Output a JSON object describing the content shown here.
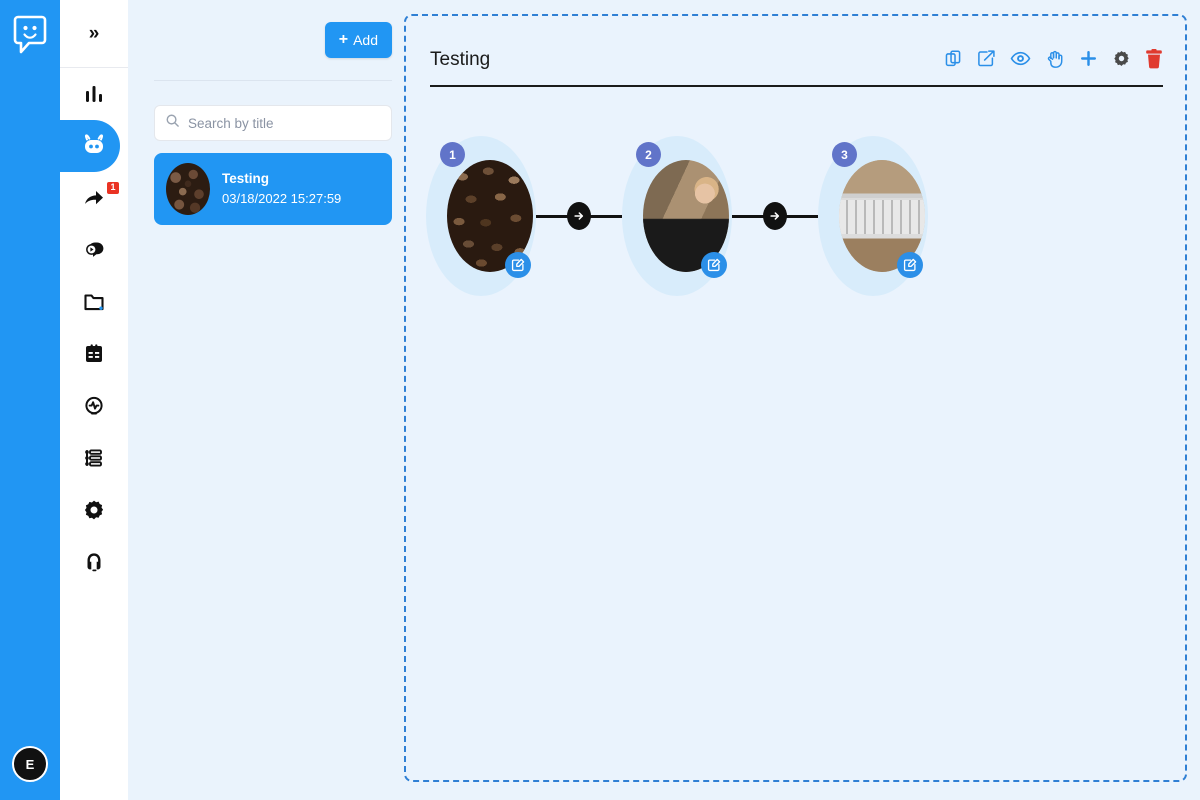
{
  "app": {
    "logo_icon": "chat-smiley-logo",
    "accent_color": "#2196f3",
    "canvas_bg": "#eaf3fd",
    "dashed_border_color": "#2f7fd4",
    "badge_color": "#6174c9",
    "danger_color": "#e03a2f"
  },
  "rail": {
    "avatar_initial": "E",
    "avatar_name": "user-avatar"
  },
  "iconbar": {
    "collapse_label": "»",
    "items": [
      {
        "name": "analytics",
        "icon": "bar-chart-icon",
        "active": false,
        "badge": ""
      },
      {
        "name": "bot",
        "icon": "robot-icon",
        "active": true,
        "badge": ""
      },
      {
        "name": "broadcast",
        "icon": "share-arrow-icon",
        "active": false,
        "badge": "1"
      },
      {
        "name": "messages",
        "icon": "chat-play-icon",
        "active": false,
        "badge": ""
      },
      {
        "name": "files",
        "icon": "folder-icon",
        "active": false,
        "badge": ""
      },
      {
        "name": "forms",
        "icon": "form-list-icon",
        "active": false,
        "badge": ""
      },
      {
        "name": "activity",
        "icon": "pulse-circle-icon",
        "active": false,
        "badge": ""
      },
      {
        "name": "tasks",
        "icon": "checklist-icon",
        "active": false,
        "badge": ""
      },
      {
        "name": "settings",
        "icon": "gear-icon",
        "active": false,
        "badge": ""
      },
      {
        "name": "support",
        "icon": "headset-icon",
        "active": false,
        "badge": ""
      }
    ]
  },
  "list_panel": {
    "add_label": "Add",
    "add_icon": "plus-icon",
    "search_placeholder": "Search by title",
    "search_value": "",
    "search_icon": "search-icon",
    "items": [
      {
        "title": "Testing",
        "timestamp": "03/18/2022 15:27:59",
        "thumbnail": "coffee-beans-thumbnail",
        "selected": true
      }
    ]
  },
  "canvas": {
    "title": "Testing",
    "tools": [
      {
        "name": "duplicate",
        "icon": "copy-icon",
        "color": "#2b8fe8",
        "label": "Duplicate"
      },
      {
        "name": "export",
        "icon": "external-link-icon",
        "color": "#2b8fe8",
        "label": "Export"
      },
      {
        "name": "preview",
        "icon": "eye-icon",
        "color": "#2b8fe8",
        "label": "Preview"
      },
      {
        "name": "pan",
        "icon": "hand-icon",
        "color": "#2b8fe8",
        "label": "Pan"
      },
      {
        "name": "add-node",
        "icon": "plus-icon",
        "color": "#2b8fe8",
        "label": "Add"
      },
      {
        "name": "settings",
        "icon": "gear-icon",
        "color": "#4a4a4a",
        "label": "Settings"
      },
      {
        "name": "delete",
        "icon": "trash-icon",
        "color": "#e03a2f",
        "label": "Delete"
      }
    ],
    "nodes": [
      {
        "number": "1",
        "image": "coffee-beans-image",
        "edit_icon": "edit-square-icon"
      },
      {
        "number": "2",
        "image": "woman-portrait-image",
        "edit_icon": "edit-square-icon"
      },
      {
        "number": "3",
        "image": "keyboard-desk-image",
        "edit_icon": "edit-square-icon"
      }
    ],
    "connectors": [
      {
        "icon": "arrow-right-icon"
      },
      {
        "icon": "arrow-right-icon"
      }
    ]
  }
}
